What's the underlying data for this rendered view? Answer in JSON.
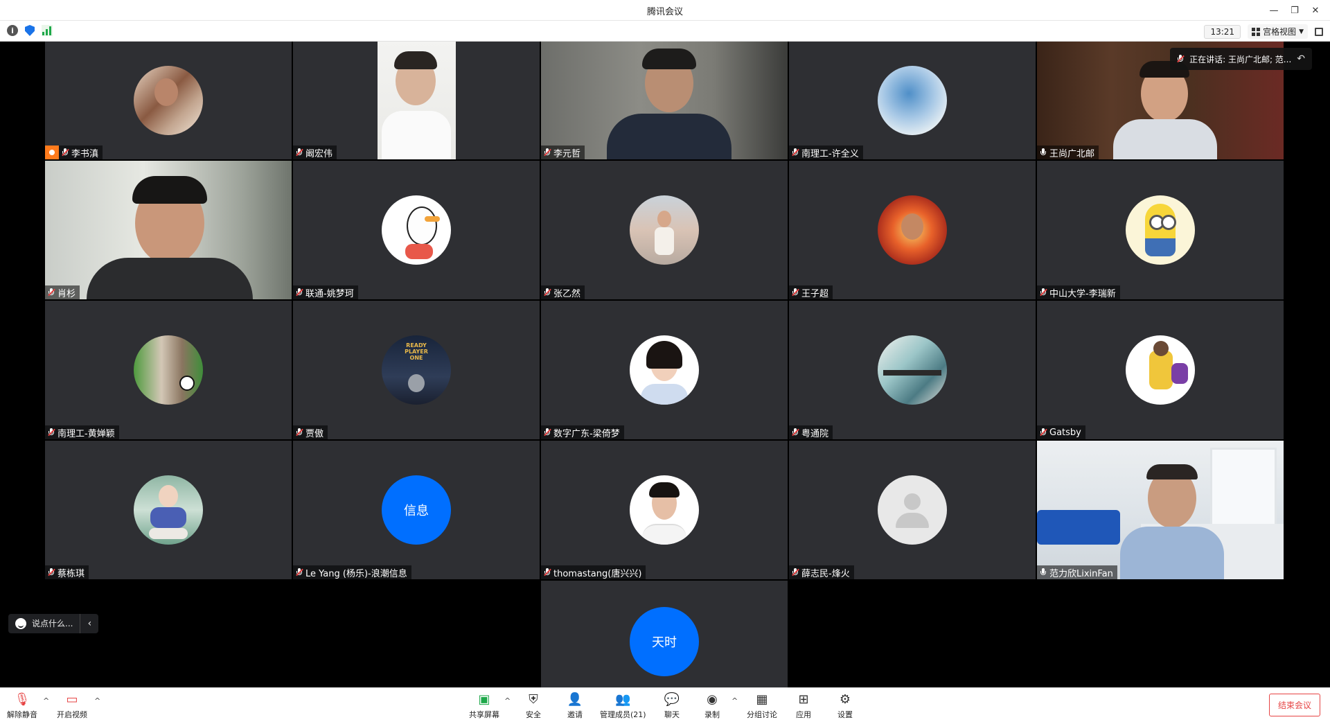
{
  "window": {
    "title": "腾讯会议"
  },
  "topbar": {
    "time": "13:21",
    "view_label": "宫格视图"
  },
  "speaking": {
    "label": "正在讲话: 王尚广北邮; 范..."
  },
  "participants": [
    {
      "name": "李书滇",
      "muted": true,
      "host": true
    },
    {
      "name": "阚宏伟",
      "muted": true
    },
    {
      "name": "李元哲",
      "muted": true
    },
    {
      "name": "南理工-许全义",
      "muted": true
    },
    {
      "name": "王尚广北邮",
      "muted": false,
      "active": true
    },
    {
      "name": "肖杉",
      "muted": true
    },
    {
      "name": "联通-姚梦珂",
      "muted": true
    },
    {
      "name": "张乙然",
      "muted": true
    },
    {
      "name": "王子超",
      "muted": true
    },
    {
      "name": "中山大学-李瑞新",
      "muted": true
    },
    {
      "name": "南理工-黄婵颖",
      "muted": true
    },
    {
      "name": "贾傲",
      "muted": true
    },
    {
      "name": "数字广东-梁倚梦",
      "muted": true
    },
    {
      "name": "粤通院",
      "muted": true
    },
    {
      "name": "Gatsby",
      "muted": true
    },
    {
      "name": "蔡栋琪",
      "muted": true
    },
    {
      "name": "Le Yang (杨乐)-浪潮信息",
      "muted": true,
      "avatar_text": "信息"
    },
    {
      "name": "thomastang(唐兴兴)",
      "muted": true
    },
    {
      "name": "薛志民-烽火",
      "muted": true
    },
    {
      "name": "范力欣LixinFan",
      "muted": false
    },
    {
      "name": "",
      "muted": true,
      "avatar_text": "天时"
    }
  ],
  "chat": {
    "placeholder": "说点什么..."
  },
  "bottombar": {
    "unmute": "解除静音",
    "video": "开启视频",
    "share": "共享屏幕",
    "security": "安全",
    "invite": "邀请",
    "members": "管理成员(21)",
    "chat": "聊天",
    "record": "录制",
    "breakout": "分组讨论",
    "apps": "应用",
    "settings": "设置",
    "end": "结束会议"
  },
  "colors": {
    "tile_bg": "#2e2f33",
    "text_avatar": "#006fff",
    "active_border": "#2ecb63",
    "end_red": "#e64343"
  }
}
